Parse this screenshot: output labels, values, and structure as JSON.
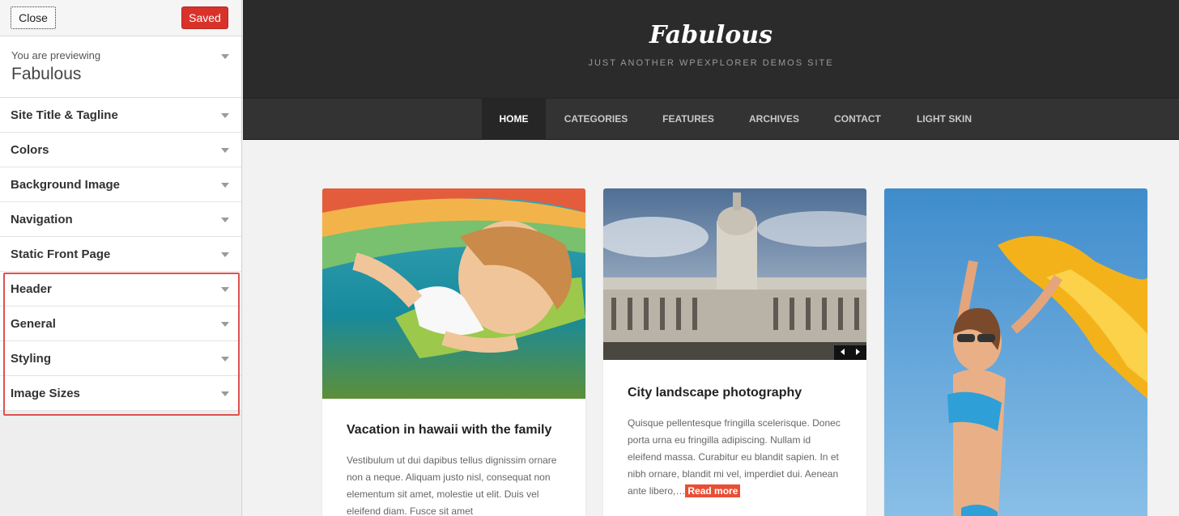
{
  "sidebar": {
    "close_label": "Close",
    "saved_label": "Saved",
    "previewing_label": "You are previewing",
    "theme_name": "Fabulous",
    "sections": [
      {
        "label": "Site Title & Tagline"
      },
      {
        "label": "Colors"
      },
      {
        "label": "Background Image"
      },
      {
        "label": "Navigation"
      },
      {
        "label": "Static Front Page"
      },
      {
        "label": "Header"
      },
      {
        "label": "General"
      },
      {
        "label": "Styling"
      },
      {
        "label": "Image Sizes"
      }
    ],
    "highlight_color": "#e0514e"
  },
  "site": {
    "logo": "Fabulous",
    "tagline": "JUST ANOTHER WPEXPLORER DEMOS SITE",
    "nav": [
      "HOME",
      "CATEGORIES",
      "FEATURES",
      "ARCHIVES",
      "CONTACT",
      "LIGHT SKIN"
    ],
    "accent_color": "#e84f35",
    "posts": [
      {
        "title": "Vacation in hawaii with the family",
        "excerpt": "Vestibulum ut dui dapibus tellus dignissim ornare non a neque. Aliquam justo nisl, consequat non elementum sit amet, molestie ut elit. Duis vel eleifend diam. Fusce sit amet",
        "image": "girl-in-hammock-photo"
      },
      {
        "title": "City landscape photography",
        "excerpt": "Quisque pellentesque fringilla scelerisque. Donec porta urna eu fringilla adipiscing. Nullam id eleifend massa. Curabitur eu blandit sapien. In et nibh ornare, blandit mi vel, imperdiet dui. Aenean ante libero,…",
        "read_more": "Read more",
        "image": "historic-building-photo"
      },
      {
        "image": "woman-with-yellow-scarf-photo"
      }
    ]
  }
}
